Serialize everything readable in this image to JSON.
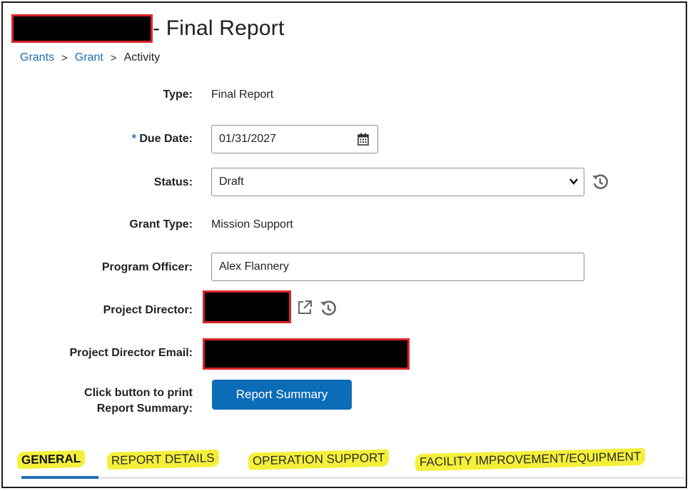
{
  "header": {
    "title": "- Final Report"
  },
  "breadcrumb": {
    "items": [
      "Grants",
      "Grant",
      "Activity"
    ],
    "separator": ">"
  },
  "form": {
    "type": {
      "label": "Type:",
      "value": "Final Report"
    },
    "due_date": {
      "required_mark": "*",
      "label": "Due Date:",
      "value": "01/31/2027"
    },
    "status": {
      "label": "Status:",
      "value": "Draft"
    },
    "grant_type": {
      "label": "Grant Type:",
      "value": "Mission Support"
    },
    "program_officer": {
      "label": "Program Officer:",
      "value": "Alex Flannery"
    },
    "project_director": {
      "label": "Project Director:"
    },
    "project_director_email": {
      "label": "Project Director Email:"
    },
    "print_summary": {
      "label_line1": "Click button to print",
      "label_line2": "Report Summary:",
      "button_label": "Report Summary"
    }
  },
  "tabs": [
    {
      "label": "GENERAL",
      "active": true
    },
    {
      "label": "REPORT DETAILS",
      "active": false
    },
    {
      "label": "OPERATION SUPPORT",
      "active": false
    },
    {
      "label": "FACILITY IMPROVEMENT/EQUIPMENT",
      "active": false
    }
  ],
  "colors": {
    "link": "#1f6fb5",
    "button": "#0b6cb8",
    "redaction_border": "#d9252b",
    "highlight": "#f4f03a"
  },
  "icons": {
    "calendar": "calendar-icon",
    "history": "history-icon",
    "external_link": "external-link-icon",
    "dropdown": "chevron-down-icon"
  }
}
